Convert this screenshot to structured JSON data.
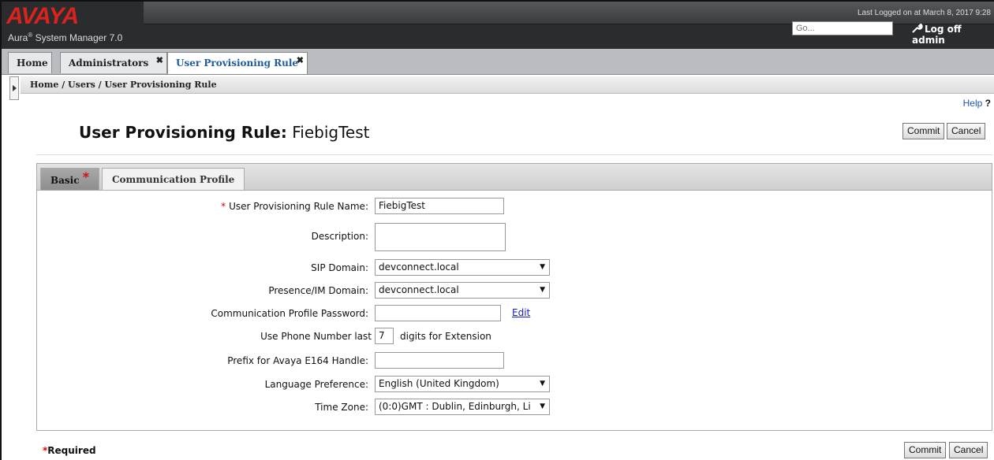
{
  "header": {
    "logo_text": "AVAYA",
    "product_name": "Aura",
    "product_sup": "®",
    "product_rest": " System Manager 7.0",
    "last_login": "Last Logged on at March 8, 2017 9:28",
    "search_placeholder": "Go...",
    "logoff_label": "Log off admin",
    "brand_color": "#d8231f"
  },
  "tabs": [
    {
      "label": "Home"
    },
    {
      "label": "Administrators",
      "close": "✖"
    },
    {
      "label": "User Provisioning Rule",
      "close": "✖",
      "active": true
    }
  ],
  "breadcrumb": "Home / Users / User Provisioning Rule",
  "help": {
    "label": "Help",
    "icon": "?"
  },
  "page": {
    "title_label": "User Provisioning Rule:",
    "title_value": "FiebigTest",
    "commit_label": "Commit",
    "cancel_label": "Cancel"
  },
  "panel_tabs": [
    {
      "label": "Basic",
      "required_mark": "*",
      "active": true
    },
    {
      "label": "Communication Profile"
    }
  ],
  "form": {
    "rule_name": {
      "label": "User Provisioning Rule Name:",
      "required_mark": "*",
      "value": "FiebigTest"
    },
    "description": {
      "label": "Description:",
      "value": ""
    },
    "sip_domain": {
      "label": "SIP Domain:",
      "value": "devconnect.local"
    },
    "presence_domain": {
      "label": "Presence/IM Domain:",
      "value": "devconnect.local"
    },
    "comm_password": {
      "label": "Communication Profile Password:",
      "value": "",
      "edit_label": "Edit"
    },
    "phone_digits": {
      "label": "Use Phone Number last",
      "value": "7",
      "suffix": "digits for Extension"
    },
    "e164_prefix": {
      "label": "Prefix for Avaya E164 Handle:",
      "value": ""
    },
    "language": {
      "label": "Language Preference:",
      "value": "English (United Kingdom)"
    },
    "timezone": {
      "label": "Time Zone:",
      "value": "(0:0)GMT : Dublin, Edinburgh, Li"
    }
  },
  "footer": {
    "required_mark": "*",
    "required_label": "Required"
  }
}
